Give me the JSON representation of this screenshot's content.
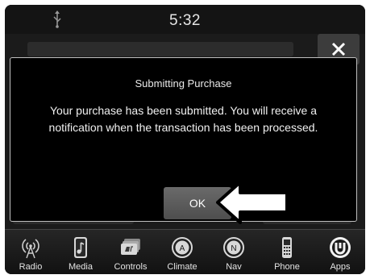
{
  "status": {
    "time": "5:32"
  },
  "dialog": {
    "title": "Submitting Purchase",
    "message": "Your purchase has been submitted. You will receive a notification when the transaction has been processed.",
    "ok_label": "OK"
  },
  "nav": {
    "items": [
      {
        "label": "Radio",
        "icon": "radio-tower-icon"
      },
      {
        "label": "Media",
        "icon": "media-note-icon"
      },
      {
        "label": "Controls",
        "icon": "controls-icon"
      },
      {
        "label": "Climate",
        "icon": "climate-icon"
      },
      {
        "label": "Nav",
        "icon": "compass-icon"
      },
      {
        "label": "Phone",
        "icon": "phone-icon"
      },
      {
        "label": "Apps",
        "icon": "apps-icon"
      }
    ]
  }
}
